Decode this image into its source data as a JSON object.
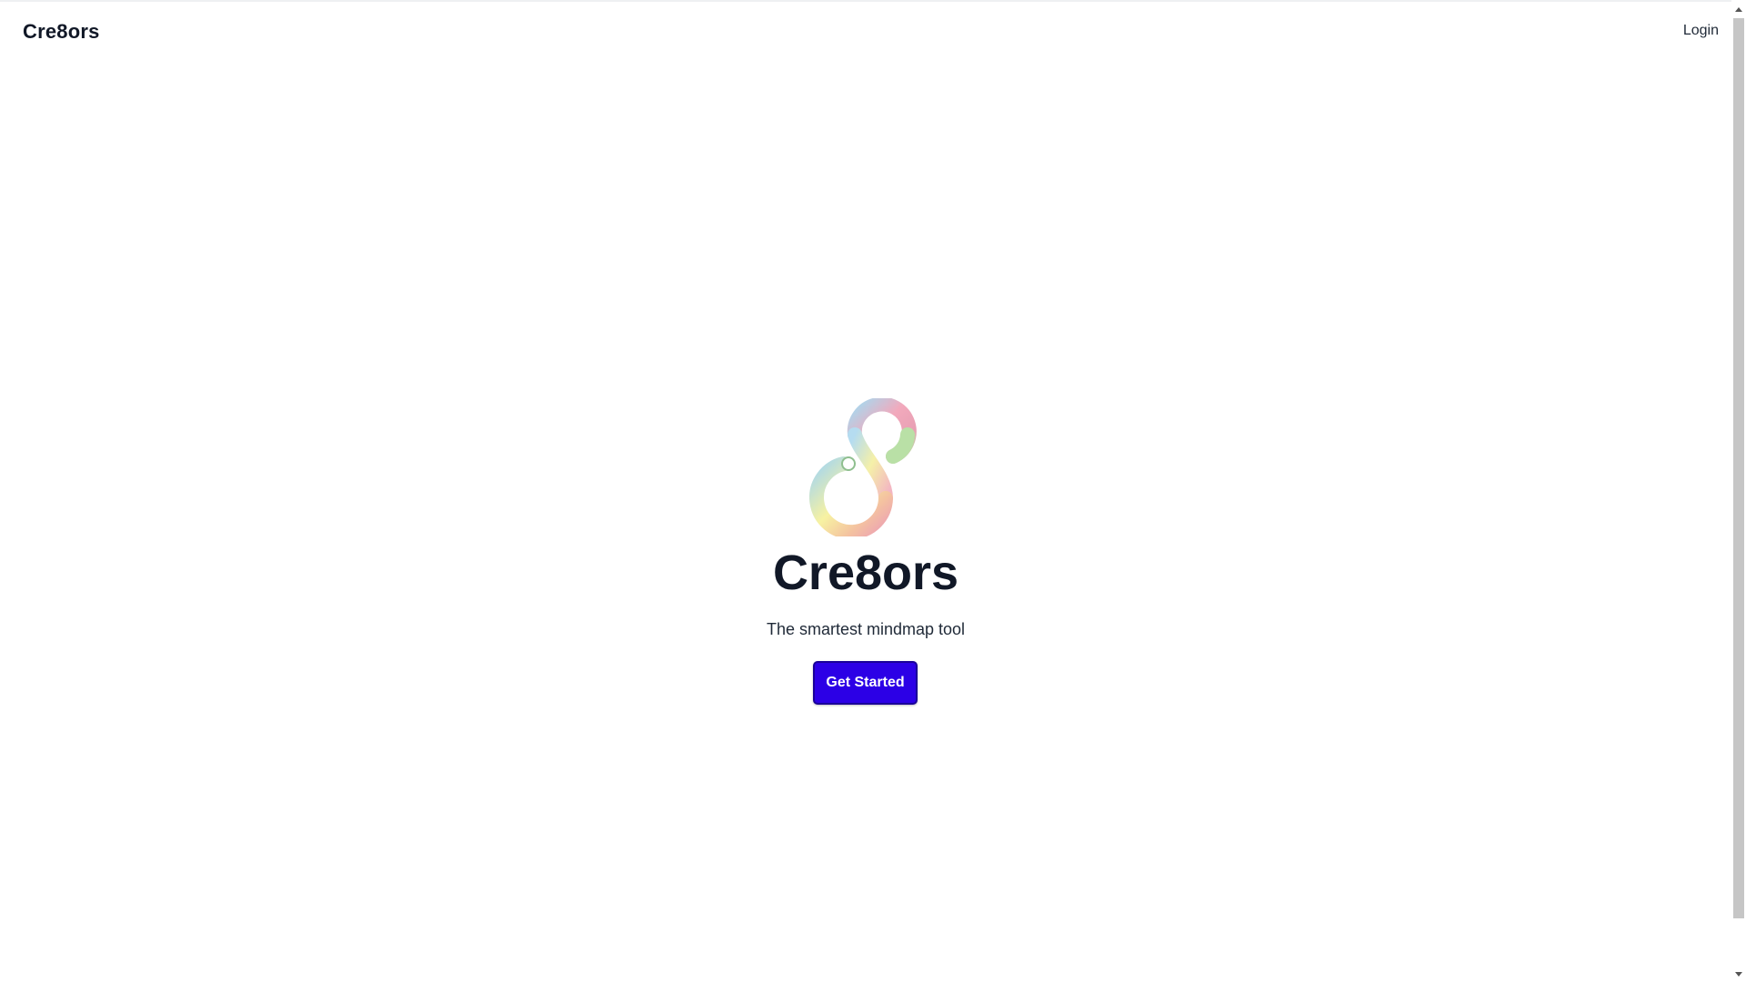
{
  "navbar": {
    "brand": "Cre8ors",
    "login_label": "Login"
  },
  "hero": {
    "logo_icon": "infinity-eight-logo",
    "title": "Cre8ors",
    "tagline": "The smartest mindmap tool",
    "cta_label": "Get Started"
  },
  "colors": {
    "cta_background": "#2c00e6",
    "text": "#111827",
    "logo_gradient": [
      "#f0a6b8",
      "#a6d8ec",
      "#f8f2a0",
      "#b8e0a8"
    ]
  }
}
